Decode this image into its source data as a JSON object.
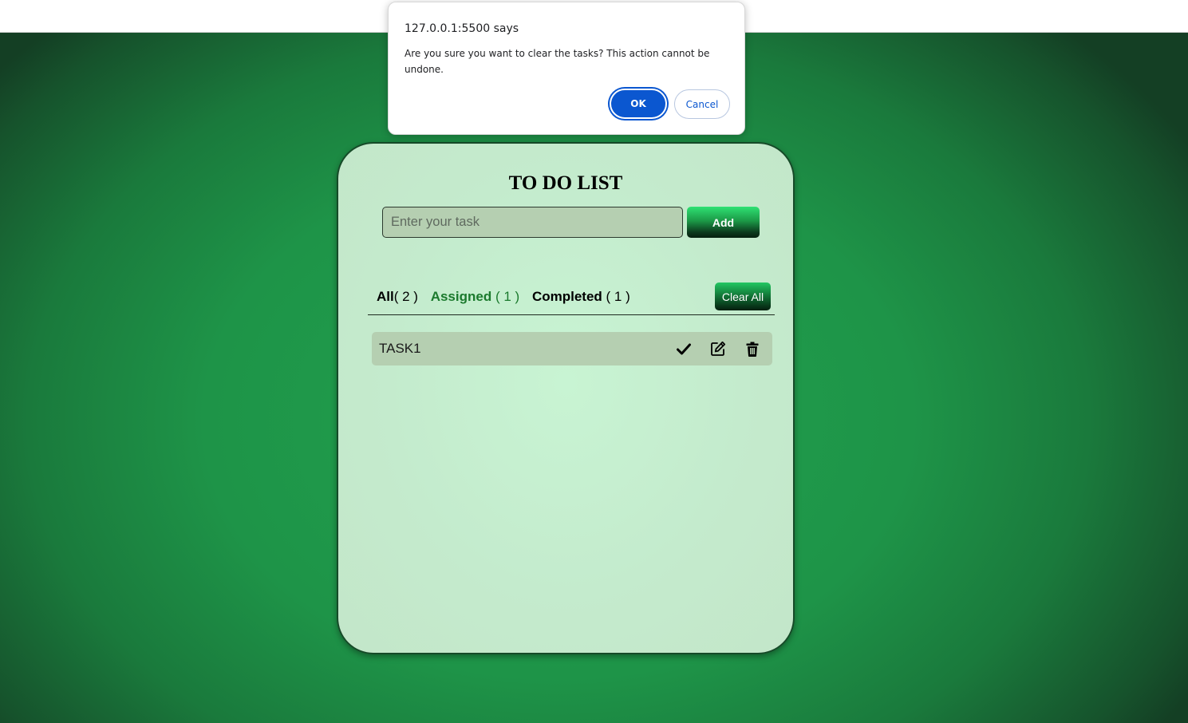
{
  "alert": {
    "title": "127.0.0.1:5500 says",
    "message": "Are you sure you want to clear the tasks? This action cannot be undone.",
    "ok_label": "OK",
    "cancel_label": "Cancel"
  },
  "app": {
    "title": "TO DO LIST",
    "input_placeholder": "Enter your task",
    "input_value": "",
    "add_label": "Add",
    "clear_all_label": "Clear All"
  },
  "filters": {
    "all": {
      "label": "All",
      "count": "( 2 )"
    },
    "assigned": {
      "label": "Assigned",
      "count": "( 1 )"
    },
    "completed": {
      "label": "Completed",
      "count": "( 1 )"
    }
  },
  "tasks": [
    {
      "text": "TASK1",
      "actions": [
        "check-icon",
        "edit-icon",
        "trash-icon"
      ]
    }
  ],
  "colors": {
    "accent_green": "#1e9448",
    "assigned_text": "#1b7a2d",
    "dialog_primary": "#0b57d0"
  }
}
